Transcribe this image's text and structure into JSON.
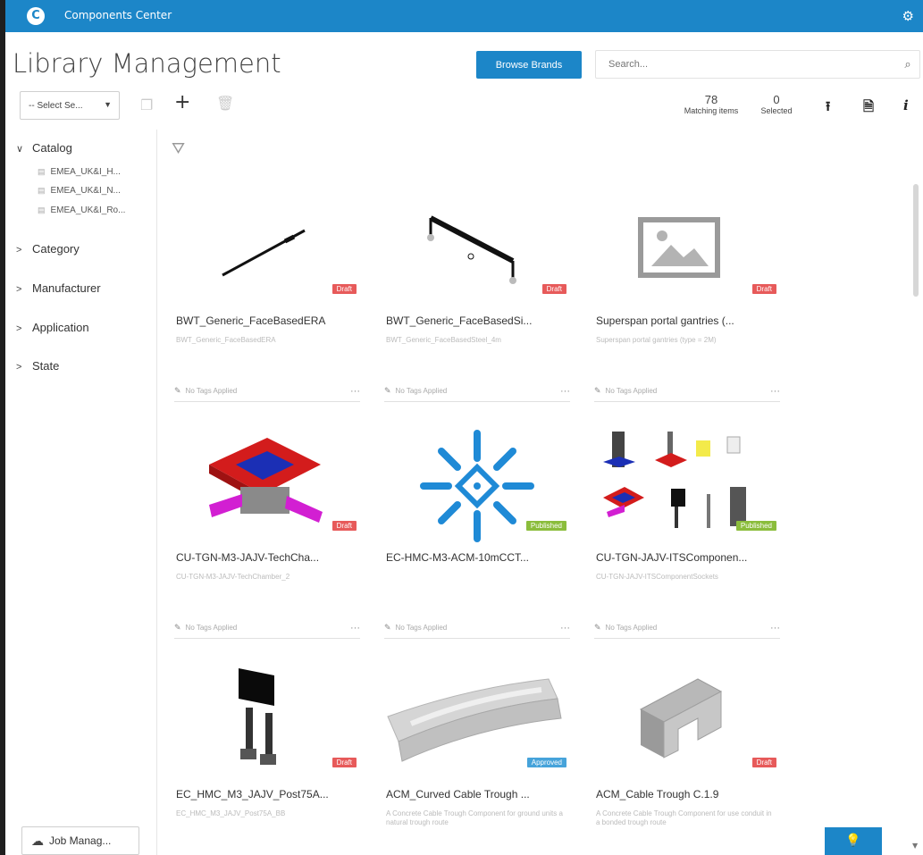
{
  "app": {
    "title": "Components Center"
  },
  "header": {
    "page_title": "Library Management",
    "browse_label": "Browse Brands",
    "search_placeholder": "Search..."
  },
  "toolbar": {
    "select_placeholder": "-- Select Se...",
    "matching_count": "78",
    "matching_label": "Matching items",
    "selected_count": "0",
    "selected_label": "Selected"
  },
  "sidebar": {
    "catalog": {
      "label": "Catalog",
      "items": [
        "EMEA_UK&I_H...",
        "EMEA_UK&I_N...",
        "EMEA_UK&I_Ro..."
      ]
    },
    "groups": [
      "Category",
      "Manufacturer",
      "Application",
      "State"
    ],
    "job_button": "Job Manag..."
  },
  "cards": [
    {
      "name": "BWT_Generic_FaceBasedERA",
      "desc": "BWT_Generic_FaceBasedERA",
      "status": "Draft",
      "tags": "No Tags Applied"
    },
    {
      "name": "BWT_Generic_FaceBasedSi...",
      "desc": "BWT_Generic_FaceBasedSteel_4m",
      "status": "Draft",
      "tags": "No Tags Applied"
    },
    {
      "name": "Superspan portal gantries (...",
      "desc": "Superspan portal gantries (type = 2M)",
      "status": "Draft",
      "tags": "No Tags Applied"
    },
    {
      "name": "CU-TGN-M3-JAJV-TechCha...",
      "desc": "CU-TGN-M3-JAJV-TechChamber_2",
      "status": "Draft",
      "tags": "No Tags Applied"
    },
    {
      "name": "EC-HMC-M3-ACM-10mCCT...",
      "desc": "",
      "status": "Published",
      "tags": "No Tags Applied"
    },
    {
      "name": "CU-TGN-JAJV-ITSComponen...",
      "desc": "CU-TGN-JAJV-ITSComponentSockets",
      "status": "Published",
      "tags": "No Tags Applied"
    },
    {
      "name": "EC_HMC_M3_JAJV_Post75A...",
      "desc": "EC_HMC_M3_JAJV_Post75A_BB",
      "status": "Draft",
      "tags": ""
    },
    {
      "name": "ACM_Curved Cable Trough ...",
      "desc": "A Concrete Cable Trough Component for ground units a natural trough route",
      "status": "Approved",
      "tags": ""
    },
    {
      "name": "ACM_Cable Trough C.1.9",
      "desc": "A Concrete Cable Trough Component for use conduit in a bonded trough route",
      "status": "Draft",
      "tags": ""
    }
  ],
  "colors": {
    "accent": "#1c86c8",
    "draft": "#e75a5a",
    "published": "#8bbd3c",
    "approved": "#46a3da"
  }
}
